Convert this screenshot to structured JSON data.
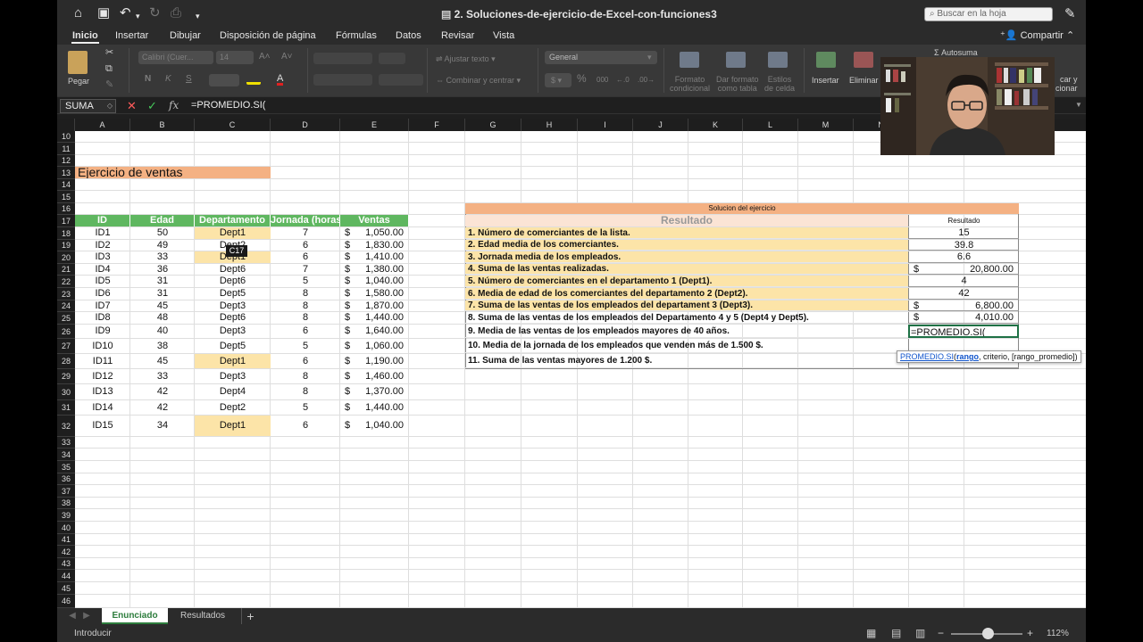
{
  "window": {
    "title": "2. Soluciones-de-ejercicio-de-Excel-con-funciones3",
    "search_placeholder": "Buscar en la hoja"
  },
  "ribbon_tabs": [
    "Inicio",
    "Insertar",
    "Dibujar",
    "Disposición de página",
    "Fórmulas",
    "Datos",
    "Revisar",
    "Vista"
  ],
  "share_label": "Compartir",
  "ribbon": {
    "paste": "Pegar",
    "font_name": "Calibri (Cuer...",
    "font_size": "14",
    "wrap": "Ajustar texto",
    "merge": "Combinar y centrar",
    "number_format": "General",
    "cond_format": "Formato\ncondicional",
    "format_table": "Dar formato\ncomo tabla",
    "cell_styles": "Estilos\nde celda",
    "insert": "Insertar",
    "delete": "Eliminar",
    "autosum": "Autosuma",
    "find": "car y\ncionar"
  },
  "formula_bar": {
    "name_box": "SUMA",
    "formula": "=PROMEDIO.SI("
  },
  "columns": [
    "A",
    "B",
    "C",
    "D",
    "E",
    "F",
    "G",
    "H",
    "I",
    "J",
    "K",
    "L",
    "M",
    "N",
    "O"
  ],
  "rows_visible": [
    "10",
    "11",
    "12",
    "13",
    "14",
    "15",
    "16",
    "17",
    "18",
    "19",
    "20",
    "21",
    "22",
    "23",
    "24",
    "25",
    "26",
    "27",
    "28",
    "29",
    "30",
    "31",
    "32",
    "33",
    "34",
    "35",
    "36",
    "37",
    "38",
    "39",
    "40",
    "41",
    "42",
    "43",
    "44",
    "45",
    "46"
  ],
  "sheet": {
    "title": "Ejercicio de ventas",
    "headers": [
      "ID",
      "Edad",
      "Departamento",
      "Jornada (horas)",
      "Ventas"
    ],
    "rows": [
      {
        "id": "ID1",
        "edad": "50",
        "dept": "Dept1",
        "horas": "7",
        "ventas": "1,050.00"
      },
      {
        "id": "ID2",
        "edad": "49",
        "dept": "Dept2",
        "horas": "6",
        "ventas": "1,830.00"
      },
      {
        "id": "ID3",
        "edad": "33",
        "dept": "Dept1",
        "horas": "6",
        "ventas": "1,410.00"
      },
      {
        "id": "ID4",
        "edad": "36",
        "dept": "Dept6",
        "horas": "7",
        "ventas": "1,380.00"
      },
      {
        "id": "ID5",
        "edad": "31",
        "dept": "Dept6",
        "horas": "5",
        "ventas": "1,040.00"
      },
      {
        "id": "ID6",
        "edad": "31",
        "dept": "Dept5",
        "horas": "8",
        "ventas": "1,580.00"
      },
      {
        "id": "ID7",
        "edad": "45",
        "dept": "Dept3",
        "horas": "8",
        "ventas": "1,870.00"
      },
      {
        "id": "ID8",
        "edad": "48",
        "dept": "Dept6",
        "horas": "8",
        "ventas": "1,440.00"
      },
      {
        "id": "ID9",
        "edad": "40",
        "dept": "Dept3",
        "horas": "6",
        "ventas": "1,640.00"
      },
      {
        "id": "ID10",
        "edad": "38",
        "dept": "Dept5",
        "horas": "5",
        "ventas": "1,060.00"
      },
      {
        "id": "ID11",
        "edad": "45",
        "dept": "Dept1",
        "horas": "6",
        "ventas": "1,190.00"
      },
      {
        "id": "ID12",
        "edad": "33",
        "dept": "Dept3",
        "horas": "8",
        "ventas": "1,460.00"
      },
      {
        "id": "ID13",
        "edad": "42",
        "dept": "Dept4",
        "horas": "8",
        "ventas": "1,370.00"
      },
      {
        "id": "ID14",
        "edad": "42",
        "dept": "Dept2",
        "horas": "5",
        "ventas": "1,440.00"
      },
      {
        "id": "ID15",
        "edad": "34",
        "dept": "Dept1",
        "horas": "6",
        "ventas": "1,040.00"
      }
    ],
    "currency": "$",
    "cell_tooltip": "C17",
    "solution": {
      "title": "Solucion del ejercicio",
      "header_left": "Resultado",
      "header_right": "Resultado",
      "items": [
        {
          "q": "1. Número de comerciantes de la lista.",
          "r": "15",
          "cur": ""
        },
        {
          "q": "2. Edad media de los comerciantes.",
          "r": "39.8",
          "cur": ""
        },
        {
          "q": "3. Jornada media de los empleados.",
          "r": "6.6",
          "cur": ""
        },
        {
          "q": "4. Suma de las ventas realizadas.",
          "r": "20,800.00",
          "cur": "$"
        },
        {
          "q": "5. Número de comerciantes en el departamento 1 (Dept1).",
          "r": "4",
          "cur": ""
        },
        {
          "q": "6. Media de edad de los comerciantes del departamento 2 (Dept2).",
          "r": "42",
          "cur": ""
        },
        {
          "q": "7. Suma de las ventas de los empleados del departament 3 (Dept3).",
          "r": "6,800.00",
          "cur": "$"
        },
        {
          "q": "8. Suma de las ventas de los empleados del Departamento 4 y 5 (Dept4 y Dept5).",
          "r": "4,010.00",
          "cur": "$"
        },
        {
          "q": "9. Media de las ventas de los empleados mayores de 40 años.",
          "r": "=PROMEDIO.SI(",
          "cur": ""
        },
        {
          "q": "10. Media de la jornada de los empleados que venden más de 1.500 $.",
          "r": "",
          "cur": ""
        },
        {
          "q": "11. Suma de las ventas mayores de 1.200 $.",
          "r": "",
          "cur": ""
        }
      ],
      "hint": {
        "fn": "PROMEDIO.SI",
        "open": "(",
        "arg1": "rango",
        "rest": ", criterio, [rango_promedio])"
      }
    }
  },
  "sheet_tabs": [
    "Enunciado",
    "Resultados"
  ],
  "status": {
    "mode": "Introducir",
    "zoom": "112%"
  }
}
